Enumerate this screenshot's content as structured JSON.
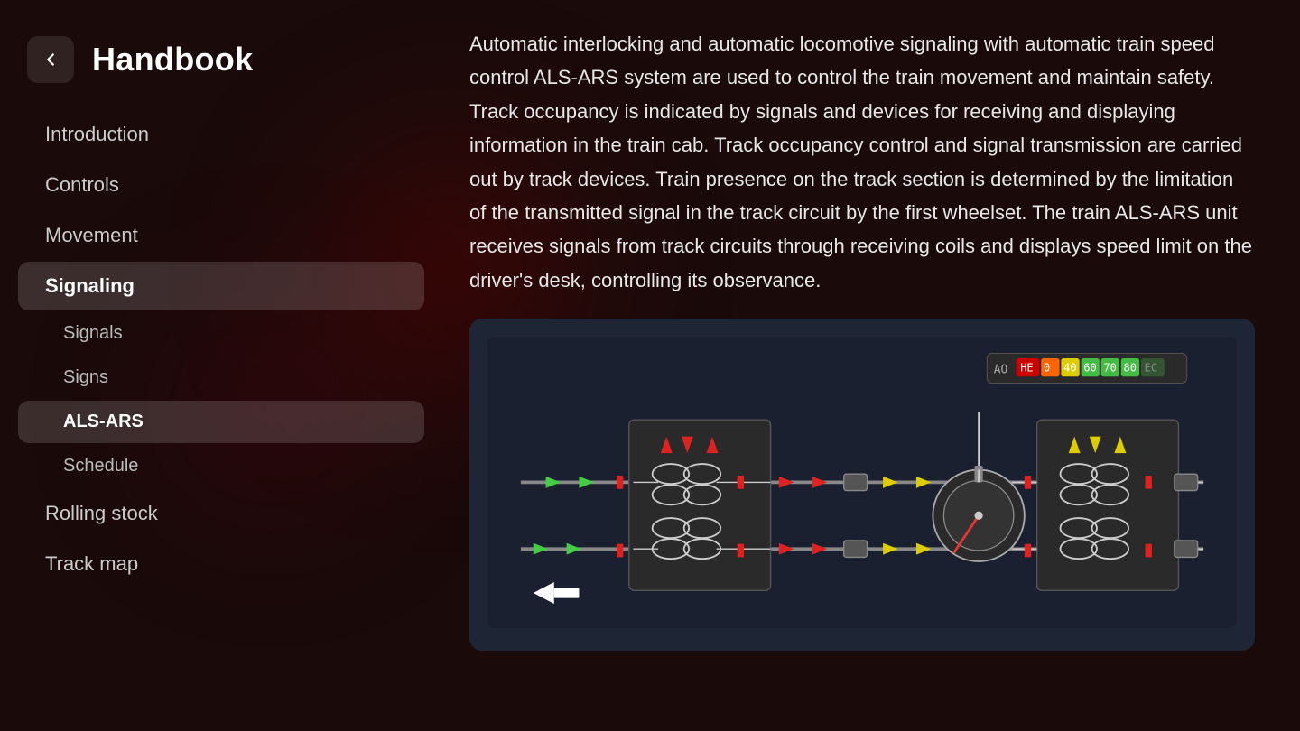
{
  "app": {
    "title": "Handbook",
    "back_label": "←"
  },
  "sidebar": {
    "items": [
      {
        "id": "introduction",
        "label": "Introduction",
        "active": false,
        "sub": false
      },
      {
        "id": "controls",
        "label": "Controls",
        "active": false,
        "sub": false
      },
      {
        "id": "movement",
        "label": "Movement",
        "active": false,
        "sub": false
      },
      {
        "id": "signaling",
        "label": "Signaling",
        "active": true,
        "sub": false
      },
      {
        "id": "signals",
        "label": "Signals",
        "active": false,
        "sub": true
      },
      {
        "id": "signs",
        "label": "Signs",
        "active": false,
        "sub": true
      },
      {
        "id": "als-ars",
        "label": "ALS-ARS",
        "active": true,
        "sub": true
      },
      {
        "id": "schedule",
        "label": "Schedule",
        "active": false,
        "sub": true
      },
      {
        "id": "rolling-stock",
        "label": "Rolling stock",
        "active": false,
        "sub": false
      },
      {
        "id": "track-map",
        "label": "Track map",
        "active": false,
        "sub": false
      }
    ]
  },
  "content": {
    "text": "Automatic interlocking and automatic locomotive signaling with automatic train speed control ALS-ARS system are used to control the train movement and maintain safety. Track occupancy is indicated by signals and devices for receiving and displaying information in the train cab. Track occupancy control and signal transmission are carried out by track devices. Train presence on the track section is determined by the limitation of the transmitted signal in the track circuit by the first wheelset. The train ALS-ARS unit receives signals from track circuits through receiving coils and displays speed limit on the driver's desk, controlling its observance."
  },
  "diagram": {
    "label": "ALS-ARS track circuit diagram"
  }
}
